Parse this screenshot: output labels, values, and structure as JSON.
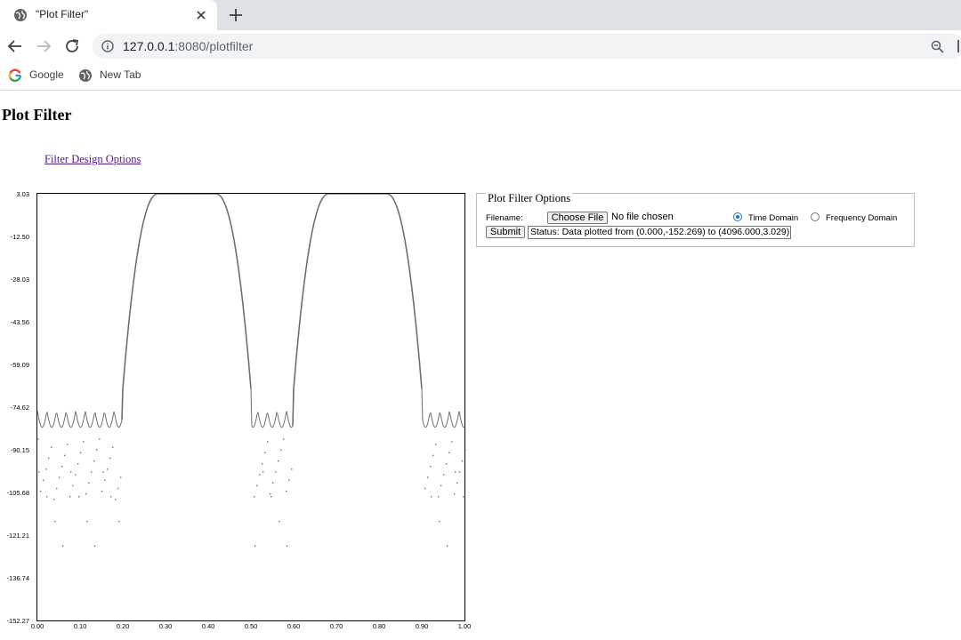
{
  "browser": {
    "tab_title": "\"Plot Filter\"",
    "url_host": "127.0.0.1",
    "url_rest": ":8080/plotfilter",
    "bookmarks": [
      "Google",
      "New Tab"
    ]
  },
  "page": {
    "title": "Plot Filter",
    "link": "Filter Design Options"
  },
  "options": {
    "legend": "Plot Filter Options",
    "filename_label": "Filename:",
    "choose_file_label": "Choose File",
    "no_file_text": "No file chosen",
    "radio_time": "Time Domain",
    "radio_freq": "Frequency Domain",
    "selected": "Time Domain",
    "submit_label": "Submit",
    "status_value": "Status: Data plotted from (0.000,-152.269) to (4096.000,3.029)"
  },
  "colors": {
    "plot": "#6e6e6e",
    "link": "#551a8b",
    "accent": "#1a73e8"
  },
  "chart_data": {
    "type": "scatter",
    "ylim": [
      -152.27,
      3.03
    ],
    "xlim": [
      0,
      1
    ],
    "y_ticks": [
      "3.03",
      "-12.50",
      "-28.03",
      "-43.56",
      "-59.09",
      "-74.62",
      "-90.15",
      "-105.68",
      "-121.21",
      "-136.74",
      "-152.27"
    ],
    "x_ticks": [
      "0.00",
      "0.10",
      "0.20",
      "0.30",
      "0.40",
      "0.50",
      "0.60",
      "0.70",
      "0.80",
      "0.90",
      "1.00"
    ],
    "passbands": [
      [
        0.2,
        0.5
      ],
      [
        0.6,
        0.9
      ]
    ],
    "passband_level": 3.03,
    "stopband_level": -72
  }
}
